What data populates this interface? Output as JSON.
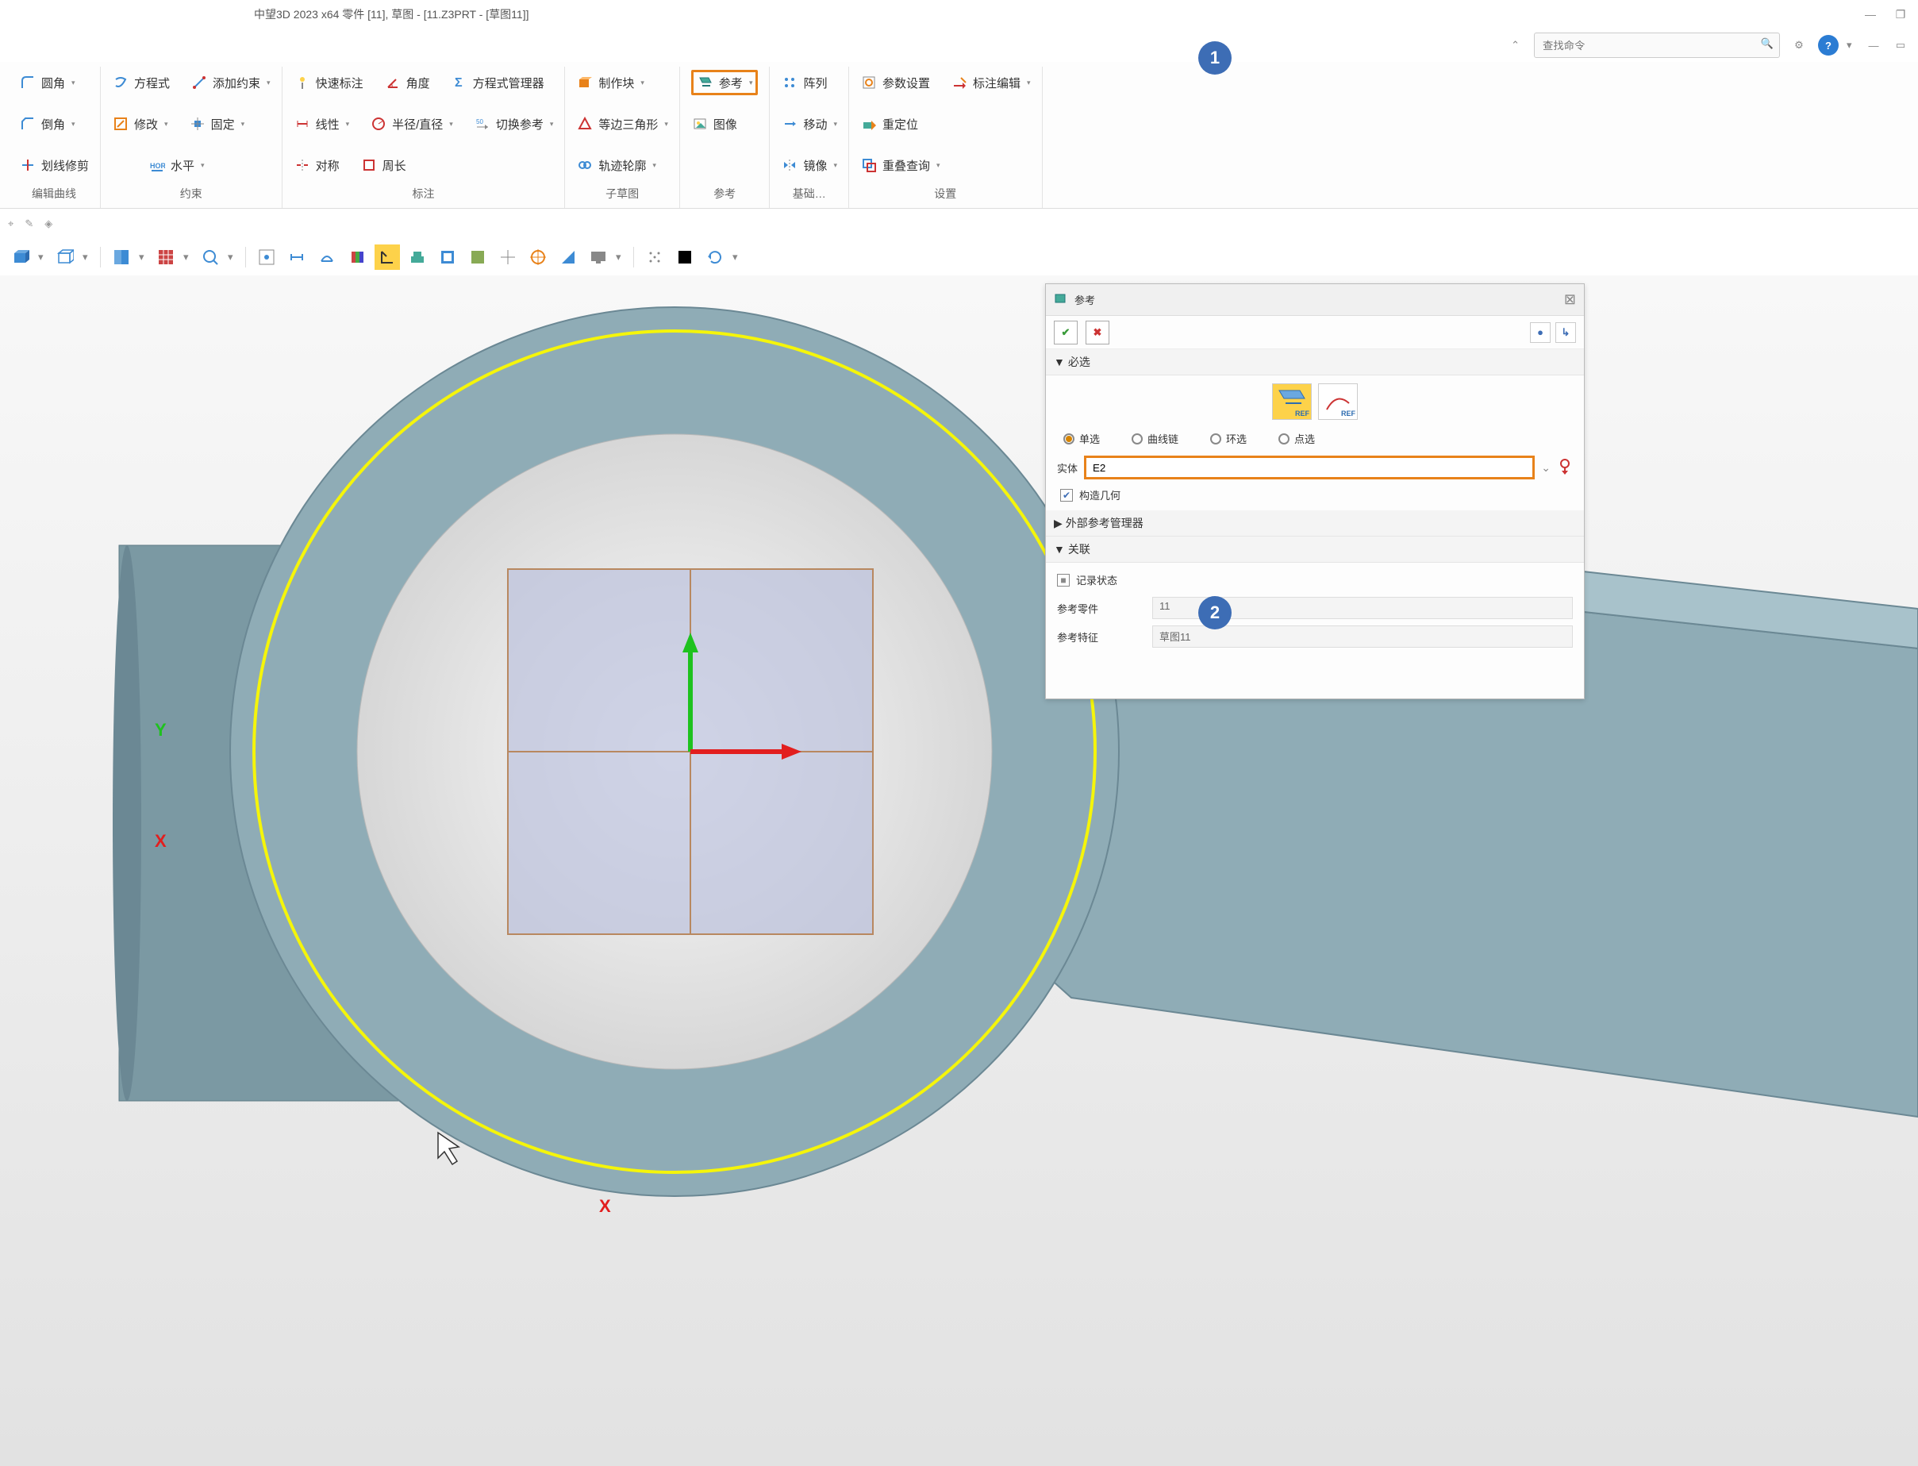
{
  "title": "中望3D 2023 x64       零件 [11],  草图 - [11.Z3PRT - [草图11]]",
  "search_placeholder": "查找命令",
  "ribbon": {
    "groups": [
      {
        "label": "编辑曲线",
        "cols": [
          [
            {
              "icon": "fillet",
              "text": "圆角",
              "dd": true
            },
            {
              "icon": "chamfer",
              "text": "倒角",
              "dd": true
            },
            {
              "icon": "trim",
              "text": "划线修剪"
            }
          ]
        ]
      },
      {
        "label": "约束",
        "cols": [
          [
            {
              "icon": "equation",
              "text": "方程式"
            },
            {
              "icon": "modify",
              "text": "修改",
              "dd": true
            },
            {
              "icon": "",
              "text": ""
            }
          ],
          [
            {
              "icon": "addconstraint",
              "text": "添加约束",
              "dd": true
            },
            {
              "icon": "fix",
              "text": "固定",
              "dd": true
            },
            {
              "icon": "horiz",
              "text": "水平",
              "dd": true
            }
          ]
        ]
      },
      {
        "label": "标注",
        "cols": [
          [
            {
              "icon": "quickdim",
              "text": "快速标注"
            },
            {
              "icon": "linear",
              "text": "线性",
              "dd": true
            },
            {
              "icon": "sym",
              "text": "对称"
            }
          ],
          [
            {
              "icon": "angle",
              "text": "角度"
            },
            {
              "icon": "radius",
              "text": "半径/直径",
              "dd": true
            },
            {
              "icon": "perimeter",
              "text": "周长"
            }
          ],
          [
            {
              "icon": "eqmgr",
              "text": "方程式管理器"
            },
            {
              "icon": "switchref",
              "text": "切换参考",
              "dd": true
            },
            {
              "icon": "",
              "text": ""
            }
          ]
        ]
      },
      {
        "label": "子草图",
        "cols": [
          [
            {
              "icon": "block",
              "text": "制作块",
              "dd": true
            },
            {
              "icon": "polygon",
              "text": "等边三角形",
              "dd": true
            },
            {
              "icon": "track",
              "text": "轨迹轮廓",
              "dd": true
            }
          ]
        ]
      },
      {
        "label": "参考",
        "cols": [
          [
            {
              "icon": "ref",
              "text": "参考",
              "dd": true,
              "highlight": true
            },
            {
              "icon": "image",
              "text": "图像"
            },
            {
              "icon": "",
              "text": ""
            }
          ]
        ]
      },
      {
        "label": "基础…",
        "cols": [
          [
            {
              "icon": "array",
              "text": "阵列"
            },
            {
              "icon": "move",
              "text": "移动",
              "dd": true
            },
            {
              "icon": "mirror",
              "text": "镜像",
              "dd": true
            }
          ]
        ]
      },
      {
        "label": "设置",
        "cols": [
          [
            {
              "icon": "params",
              "text": "参数设置"
            },
            {
              "icon": "repos",
              "text": "重定位"
            },
            {
              "icon": "overlap",
              "text": "重叠查询",
              "dd": true
            }
          ],
          [
            {
              "icon": "dimedit",
              "text": "标注编辑",
              "dd": true
            },
            {
              "icon": "",
              "text": ""
            },
            {
              "icon": "",
              "text": ""
            }
          ]
        ]
      }
    ]
  },
  "panel": {
    "title": "参考",
    "sections": {
      "required": "必选",
      "ext_ref_mgr": "外部参考管理器",
      "related": "关联"
    },
    "radios": {
      "single": "单选",
      "curve_chain": "曲线链",
      "ring": "环选",
      "point": "点选"
    },
    "radio_selected": "single",
    "entity_label": "实体",
    "entity_value": "E2",
    "construct_geom": "构造几何",
    "record_state": "记录状态",
    "ref_part_label": "参考零件",
    "ref_part_value": "11",
    "ref_feature_label": "参考特征",
    "ref_feature_value": "草图11"
  },
  "callouts": {
    "one": "1",
    "two": "2"
  }
}
